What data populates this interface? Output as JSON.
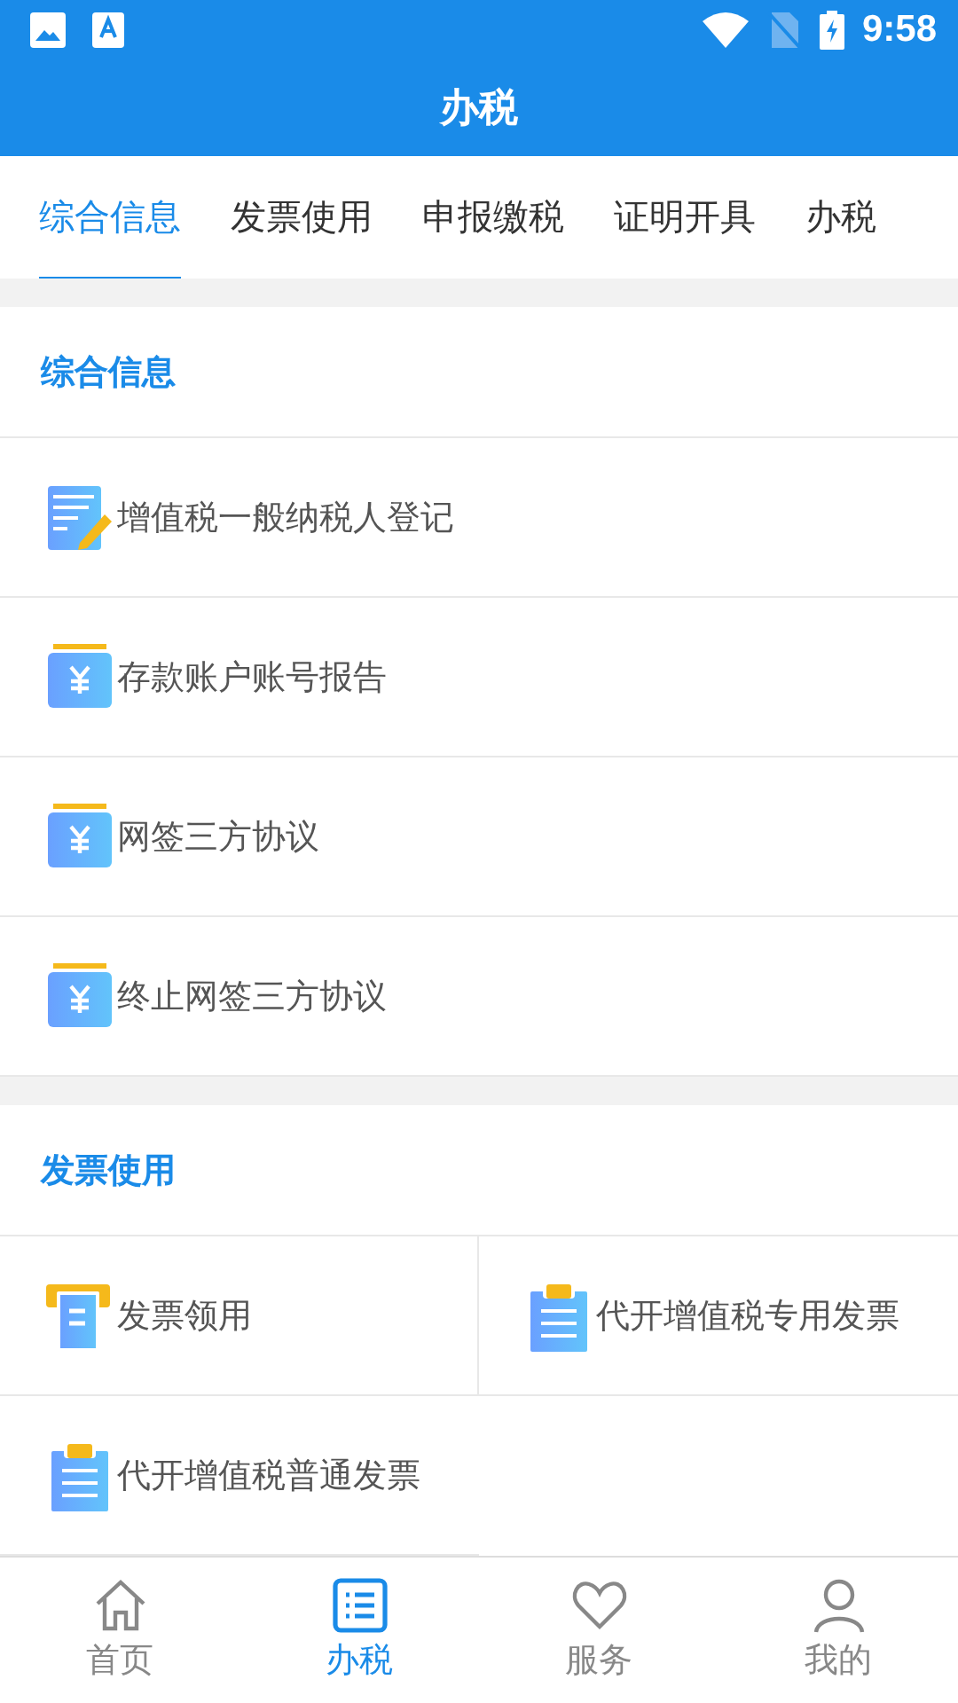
{
  "status_bar": {
    "time": "9:58"
  },
  "app_bar": {
    "title": "办税"
  },
  "tabs": [
    {
      "label": "综合信息",
      "selected": true
    },
    {
      "label": "发票使用",
      "selected": false
    },
    {
      "label": "申报缴税",
      "selected": false
    },
    {
      "label": "证明开具",
      "selected": false
    },
    {
      "label": "办税",
      "selected": false
    }
  ],
  "sections": [
    {
      "title": "综合信息",
      "kind": "list",
      "items": [
        {
          "label": "增值税一般纳税人登记",
          "kind": "pen"
        },
        {
          "label": "存款账户账号报告",
          "kind": "yen"
        },
        {
          "label": "网签三方协议",
          "kind": "yen"
        },
        {
          "label": "终止网签三方协议",
          "kind": "yen"
        }
      ]
    },
    {
      "title": "发票使用",
      "kind": "grid",
      "items": [
        {
          "label": "发票领用",
          "kind": "receipt"
        },
        {
          "label": "代开增值税专用发票",
          "kind": "clipboard"
        },
        {
          "label": "代开增值税普通发票",
          "kind": "clipboard"
        }
      ]
    }
  ],
  "bottom_nav": [
    {
      "label": "首页",
      "kind": "home",
      "selected": false
    },
    {
      "label": "办税",
      "kind": "list",
      "selected": true
    },
    {
      "label": "服务",
      "kind": "heart",
      "selected": false
    },
    {
      "label": "我的",
      "kind": "person",
      "selected": false
    }
  ]
}
